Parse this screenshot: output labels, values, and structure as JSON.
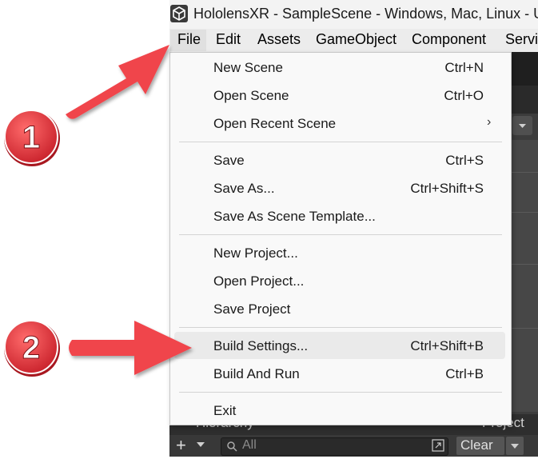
{
  "window": {
    "title": "HololensXR - SampleScene - Windows, Mac, Linux - Un"
  },
  "menubar": {
    "items": [
      "File",
      "Edit",
      "Assets",
      "GameObject",
      "Component",
      "Servic"
    ]
  },
  "file_menu": {
    "groups": [
      [
        {
          "label": "New Scene",
          "shortcut": "Ctrl+N"
        },
        {
          "label": "Open Scene",
          "shortcut": "Ctrl+O"
        },
        {
          "label": "Open Recent Scene",
          "shortcut": "",
          "submenu": true
        }
      ],
      [
        {
          "label": "Save",
          "shortcut": "Ctrl+S"
        },
        {
          "label": "Save As...",
          "shortcut": "Ctrl+Shift+S"
        },
        {
          "label": "Save As Scene Template...",
          "shortcut": ""
        }
      ],
      [
        {
          "label": "New Project...",
          "shortcut": ""
        },
        {
          "label": "Open Project...",
          "shortcut": ""
        },
        {
          "label": "Save Project",
          "shortcut": ""
        }
      ],
      [
        {
          "label": "Build Settings...",
          "shortcut": "Ctrl+Shift+B",
          "highlighted": true
        },
        {
          "label": "Build And Run",
          "shortcut": "Ctrl+B"
        }
      ],
      [
        {
          "label": "Exit",
          "shortcut": ""
        }
      ]
    ]
  },
  "bottom_panel": {
    "hierarchy_tab": "Hierarchy",
    "project_tab": "Project",
    "search_placeholder": "All",
    "clear_label": "Clear",
    "add_label": "+"
  },
  "annotations": {
    "step1": "1",
    "step2": "2"
  },
  "colors": {
    "arrow_red": "#f0444c",
    "badge_red": "#e8333b",
    "menu_bg": "#f9f9f9",
    "highlight": "#eaeaea",
    "editor_dark": "#3c3c3c"
  }
}
